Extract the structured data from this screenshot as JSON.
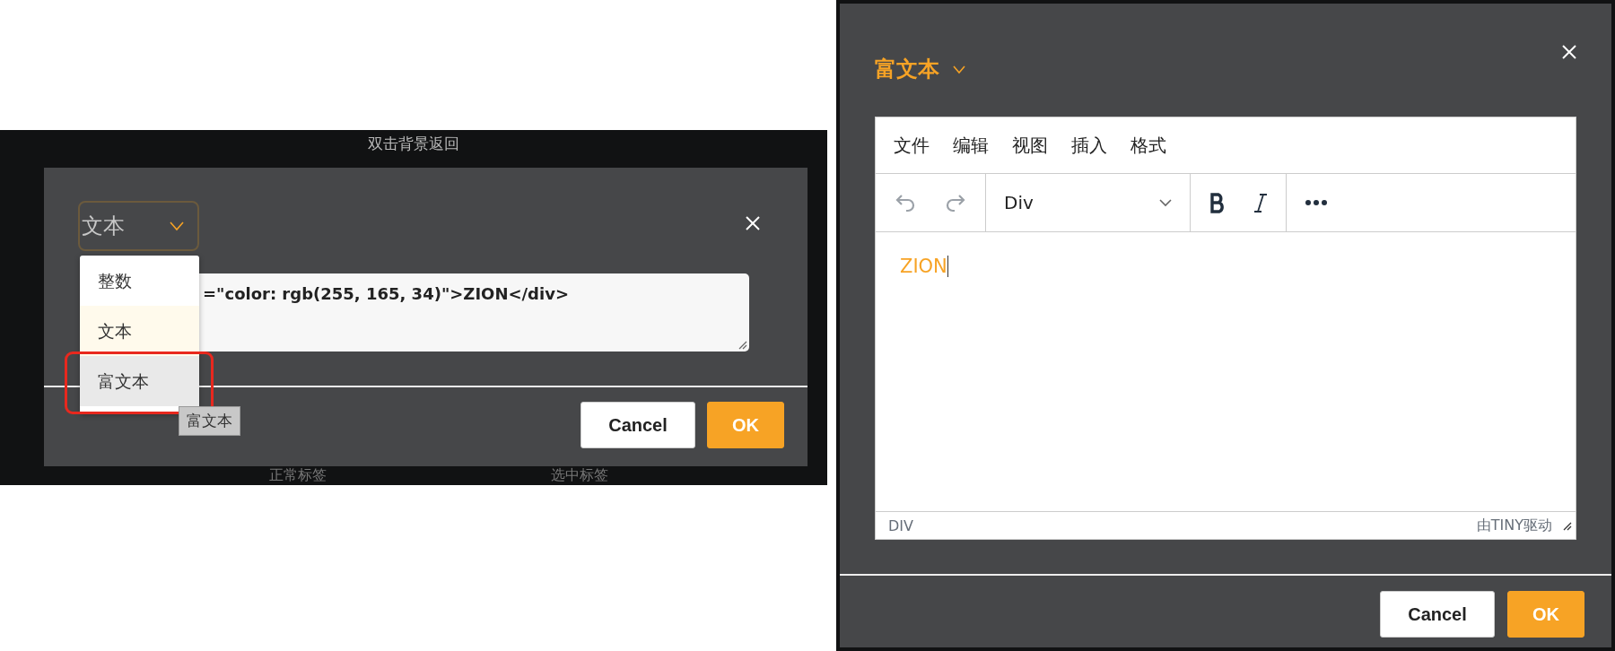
{
  "left_screenshot": {
    "background_hint": "双击背景返回",
    "dialog": {
      "type_select": {
        "value": "文本"
      },
      "options": [
        {
          "label": "整数",
          "selected": false,
          "hovered": false
        },
        {
          "label": "文本",
          "selected": true,
          "hovered": false
        },
        {
          "label": "富文本",
          "selected": false,
          "hovered": true
        }
      ],
      "tooltip": "富文本",
      "code_value": "=\"color: rgb(255, 165, 34)\">ZION</div>",
      "buttons": [
        {
          "label": "Cancel",
          "kind": "secondary"
        },
        {
          "label": "OK",
          "kind": "primary"
        }
      ]
    },
    "background_tabs": [
      "正常标签",
      "选中标签"
    ]
  },
  "right_screenshot": {
    "type_select": {
      "value": "富文本"
    },
    "editor": {
      "menu": [
        "文件",
        "编辑",
        "视图",
        "插入",
        "格式"
      ],
      "block_format": "Div",
      "content": "ZION",
      "path": "DIV",
      "branding": "由TINY驱动"
    },
    "buttons": [
      {
        "label": "Cancel",
        "kind": "secondary"
      },
      {
        "label": "OK",
        "kind": "primary"
      }
    ]
  }
}
